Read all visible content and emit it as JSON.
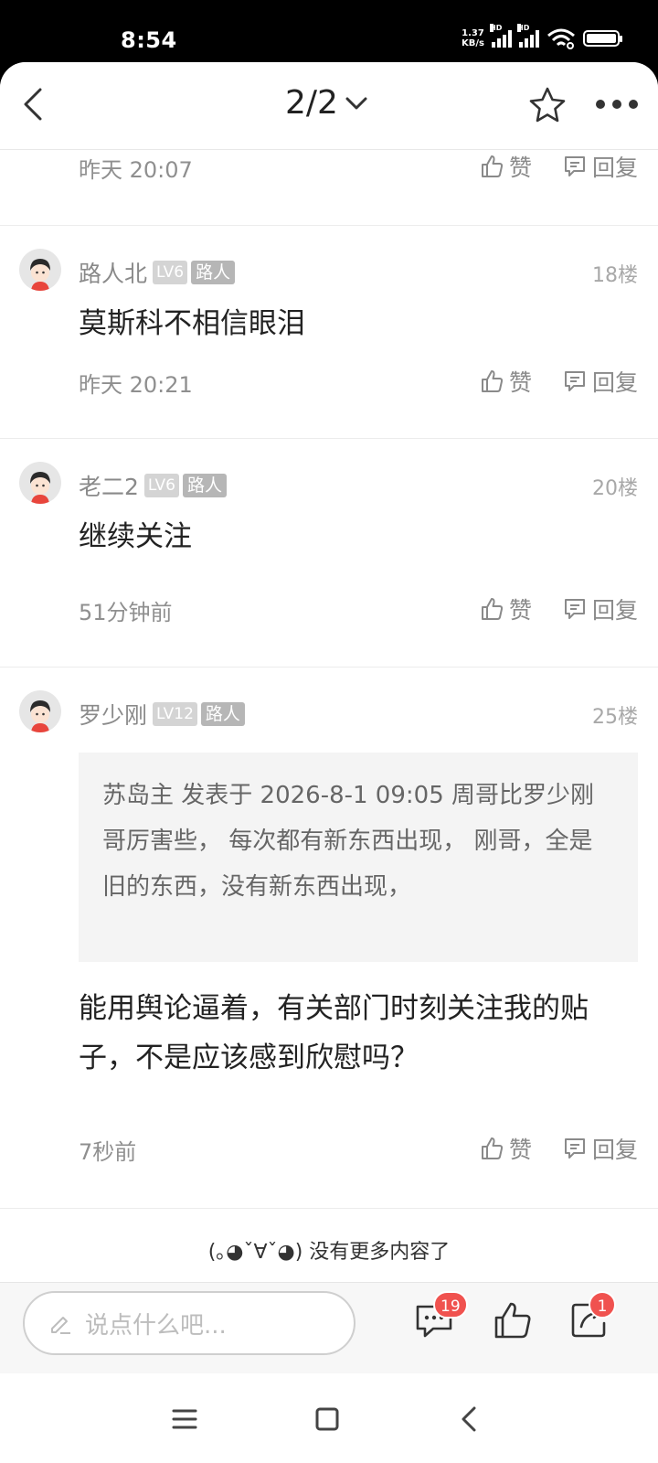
{
  "status": {
    "time": "8:54",
    "net_speed_value": "1.37",
    "net_speed_unit": "KB/s",
    "hd1": "HD",
    "hd2": "HD"
  },
  "nav": {
    "page_indicator": "2/2"
  },
  "top_partial": {
    "time": "昨天 20:07",
    "like_label": "赞",
    "reply_label": "回复"
  },
  "posts": [
    {
      "username": "路人北",
      "level": "LV6",
      "role": "路人",
      "floor": "18楼",
      "text": "莫斯科不相信眼泪",
      "time": "昨天 20:21",
      "like_label": "赞",
      "reply_label": "回复"
    },
    {
      "username": "老二2",
      "level": "LV6",
      "role": "路人",
      "floor": "20楼",
      "text": "继续关注",
      "time": "51分钟前",
      "like_label": "赞",
      "reply_label": "回复"
    },
    {
      "username": "罗少刚",
      "level": "LV12",
      "role": "路人",
      "floor": "25楼",
      "quote": "苏岛主 发表于 2026-8-1 09:05 周哥比罗少刚哥厉害些， 每次都有新东西出现， 刚哥，全是旧的东西，没有新东西出现，",
      "text": "能用舆论逼着，有关部门时刻关注我的贴子，不是应该感到欣慰吗？",
      "time": "7秒前",
      "like_label": "赞",
      "reply_label": "回复"
    }
  ],
  "end_note": "(｡◕ˇ∀ˇ◕) 没有更多内容了",
  "reply_bar": {
    "placeholder": "说点什么吧...",
    "comment_count": "19",
    "share_count": "1"
  },
  "colors": {
    "badge_red": "#f0524f",
    "text_gray": "#8a8a8a"
  }
}
